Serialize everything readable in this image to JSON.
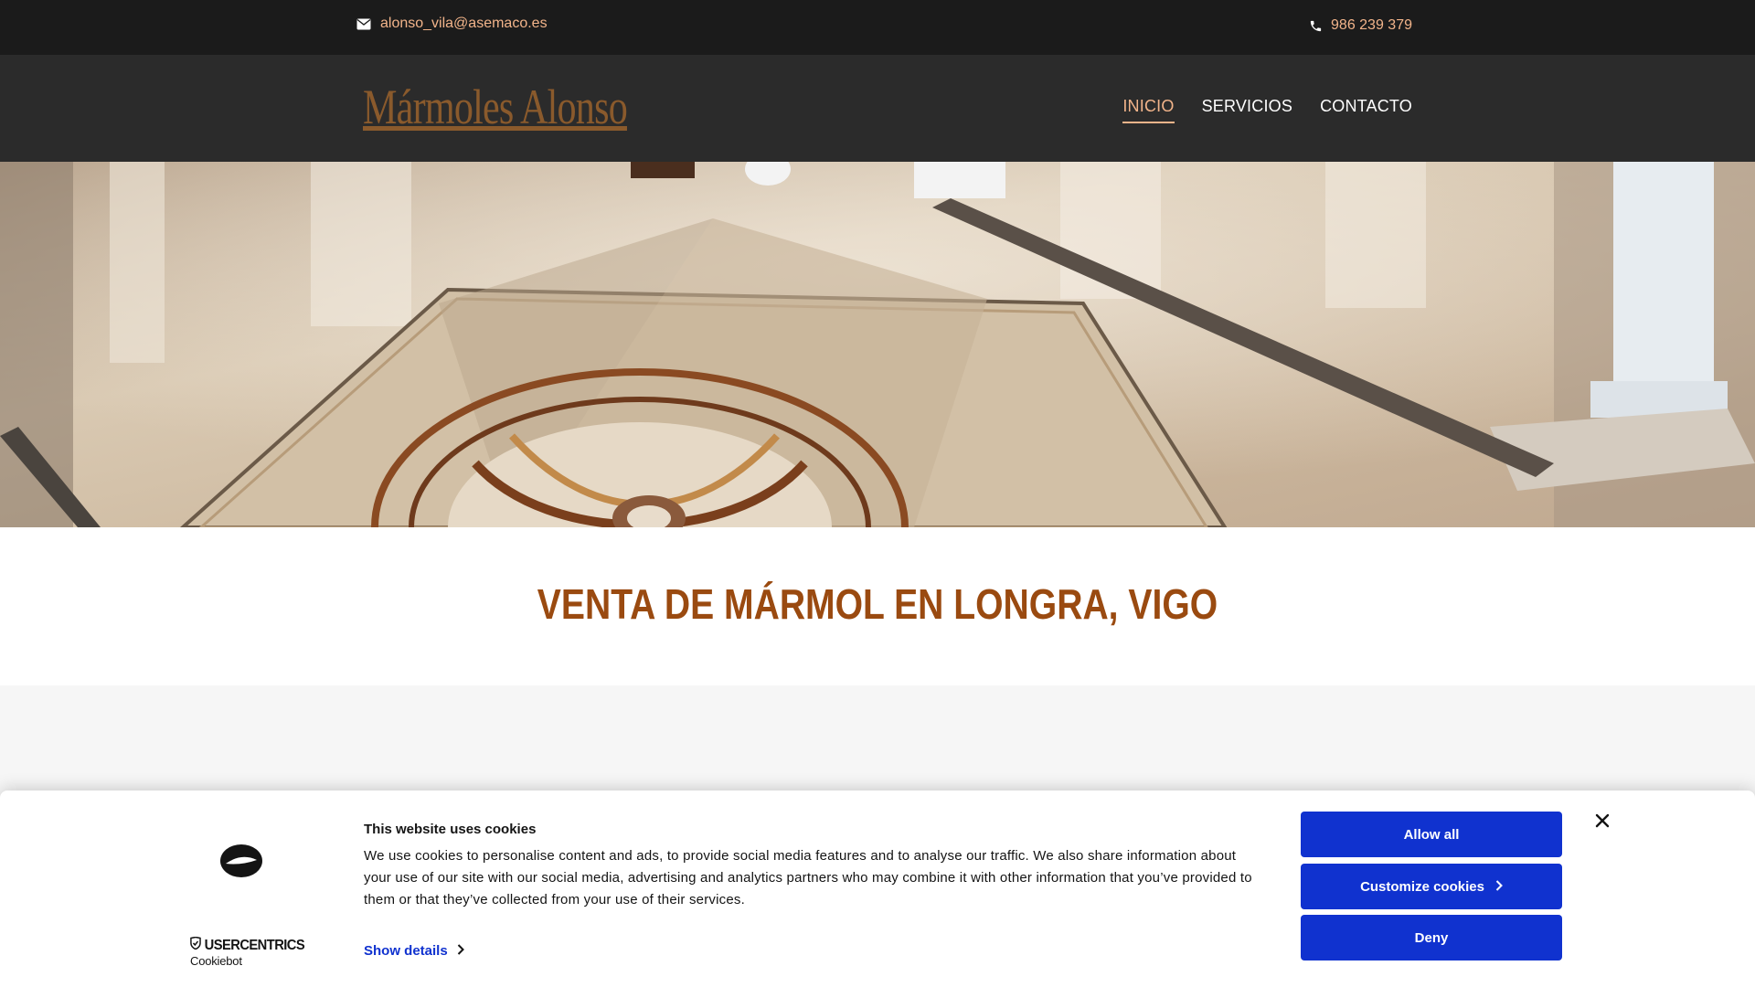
{
  "topbar": {
    "email": "alonso_vila@asemaco.es",
    "phone": "986 239 379",
    "email_icon": "envelope-icon",
    "phone_icon": "phone-icon"
  },
  "header": {
    "logo_text": "Mármoles Alonso",
    "nav": [
      {
        "label": "INICIO",
        "active": true
      },
      {
        "label": "SERVICIOS",
        "active": false
      },
      {
        "label": "CONTACTO",
        "active": false
      }
    ]
  },
  "hero": {
    "image": "marble-floor-photo"
  },
  "main": {
    "title": "VENTA DE MÁRMOL EN LONGRA, VIGO"
  },
  "cookie_banner": {
    "title": "This website uses cookies",
    "text": "We use cookies to personalise content and ads, to provide social media features and to analyse our traffic. We also share information about your use of our site with our social media, advertising and analytics partners who may combine it with other information that you’ve provided to them or that they’ve collected from your use of their services.",
    "show_details": "Show details",
    "allow_all": "Allow all",
    "customize": "Customize cookies",
    "deny": "Deny",
    "brand_name": "USERCENTRICS",
    "brand_sub": "Cookiebot",
    "button_color": "#1032cf"
  },
  "colors": {
    "accent": "#f2b48a",
    "title": "#9a4a10",
    "topbar_bg": "#1b1b1b",
    "header_bg": "#2b2b2b"
  }
}
